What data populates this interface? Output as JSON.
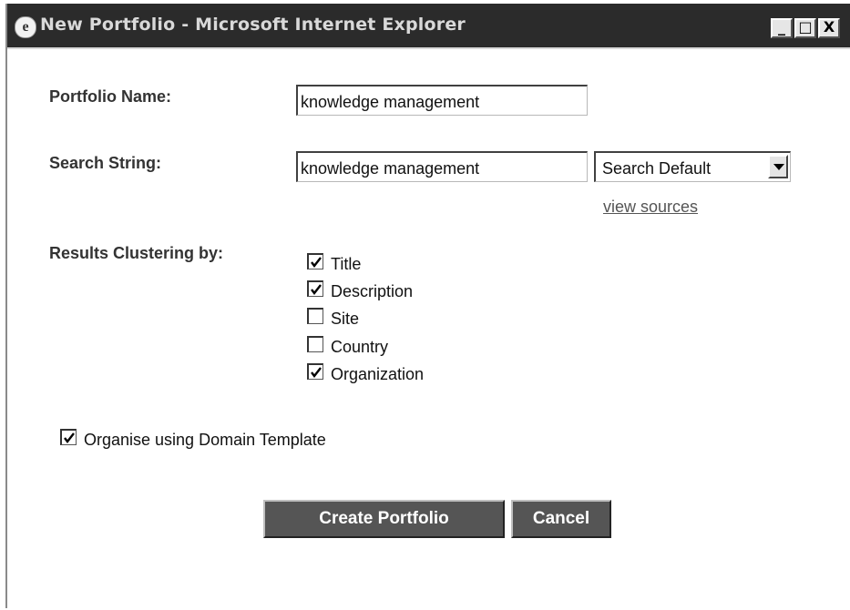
{
  "window": {
    "title": "New Portfolio - Microsoft Internet Explorer",
    "controls": {
      "minimize": "_",
      "maximize": "□",
      "close": "X"
    }
  },
  "form": {
    "portfolio_name_label": "Portfolio Name:",
    "portfolio_name_value": "knowledge management",
    "search_string_label": "Search String:",
    "search_string_value": "knowledge management",
    "search_source_selected": "Search Default",
    "view_sources_link": "view sources",
    "clustering_label": "Results Clustering by:",
    "clustering_options": [
      {
        "label": "Title",
        "checked": true
      },
      {
        "label": "Description",
        "checked": true
      },
      {
        "label": "Site",
        "checked": false
      },
      {
        "label": "Country",
        "checked": false
      },
      {
        "label": "Organization",
        "checked": true
      }
    ],
    "domain_template_label": "Organise using Domain Template",
    "domain_template_checked": true
  },
  "buttons": {
    "create": "Create Portfolio",
    "cancel": "Cancel"
  },
  "icons": {
    "title_icon": "internet-explorer-icon",
    "checkbox_mark": "checkmark-icon",
    "dropdown": "chevron-down-icon"
  }
}
